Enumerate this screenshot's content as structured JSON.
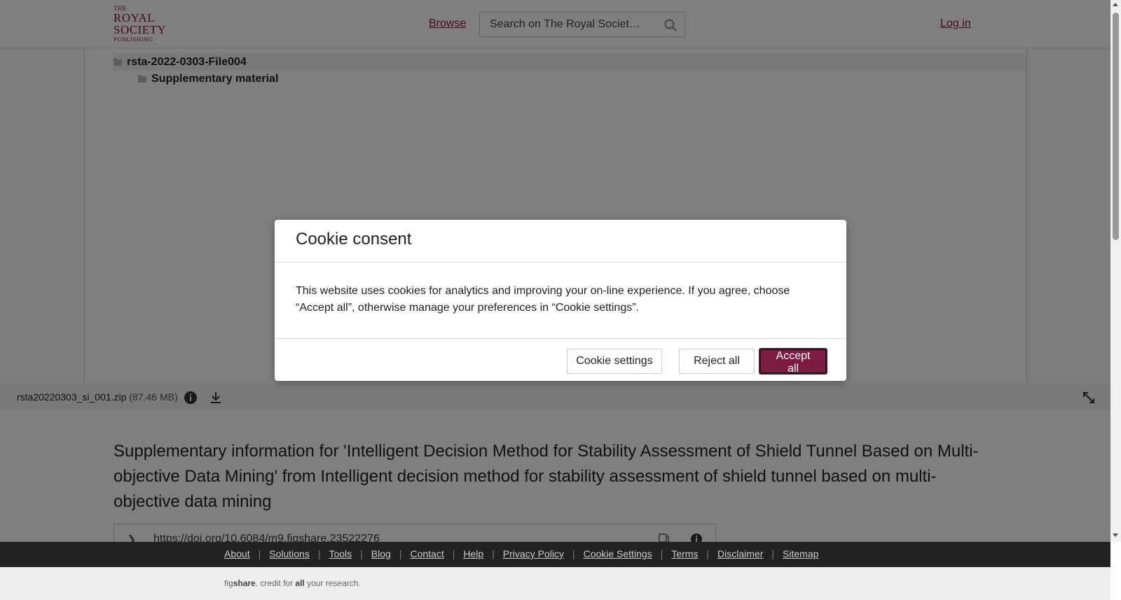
{
  "header": {
    "logo": {
      "line1": "THE",
      "line2": "ROYAL",
      "line3": "SOCIETY",
      "line4": "PUBLISHING"
    },
    "browse_label": "Browse",
    "search_placeholder": "Search on The Royal Societ…",
    "login_label": "Log in"
  },
  "viewer": {
    "tree": [
      {
        "label": "rsta-2022-0303-File004"
      },
      {
        "label": "Supplementary material"
      }
    ],
    "file": {
      "name": "rsta20220303_si_001.zip",
      "size": "(87.46 MB)"
    }
  },
  "article": {
    "title": "Supplementary information for 'Intelligent Decision Method for Stability Assessment of Shield Tunnel Based on Multi-objective Data Mining' from Intelligent decision method for stability assessment of shield tunnel based on multi-objective data mining",
    "doi": "https://doi.org/10.6084/m9.figshare.23522276"
  },
  "footer": {
    "links": [
      "About",
      "Solutions",
      "Tools",
      "Blog",
      "Contact",
      "Help",
      "Privacy Policy",
      "Cookie Settings",
      "Terms",
      "Disclaimer",
      "Sitemap"
    ],
    "credit": {
      "fig": "fig",
      "share": "share",
      "mid": ". credit for ",
      "all": "all",
      "end": " your research."
    }
  },
  "cookie_modal": {
    "title": "Cookie consent",
    "body": "This website uses cookies for analytics and improving your on-line experience. If you agree, choose “Accept all”, otherwise manage your preferences in “Cookie settings”.",
    "settings_label": "Cookie settings",
    "reject_label": "Reject all",
    "accept_label": "Accept all"
  },
  "colors": {
    "brand": "#8a1538",
    "accept_button": "#7d1a3f"
  }
}
